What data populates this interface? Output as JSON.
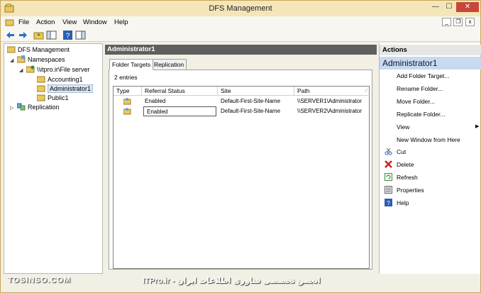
{
  "window": {
    "title": "DFS Management",
    "controls": {
      "minimize": "—",
      "maximize": "☐",
      "close": "✕"
    }
  },
  "menu": {
    "items": [
      "File",
      "Action",
      "View",
      "Window",
      "Help"
    ],
    "mdi": {
      "minimize": "_",
      "restore": "❐",
      "close": "x"
    }
  },
  "tree": {
    "root": "DFS Management",
    "namespaces": "Namespaces",
    "namespace": "\\\\itpro.ir\\File server",
    "folders": [
      "Accounting1",
      "Administrator1",
      "Public1"
    ],
    "replication": "Replication"
  },
  "center": {
    "header": "Administrator1",
    "tabs": [
      "Folder Targets",
      "Replication"
    ],
    "entries": "2 entries",
    "columns": [
      "Type",
      "Referral Status",
      "Site",
      "Path"
    ],
    "rows": [
      {
        "status": "Enabled",
        "site": "Default-First-Site-Name",
        "path": "\\\\SERVER1\\Administrator"
      },
      {
        "status": "Enabled",
        "site": "Default-First-Site-Name",
        "path": "\\\\SERVER2\\Administrator"
      }
    ]
  },
  "actions": {
    "header": "Actions",
    "section": "Administrator1",
    "items": [
      "Add Folder Target...",
      "Rename Folder...",
      "Move Folder...",
      "Replicate Folder...",
      "View",
      "New Window from Here",
      "Cut",
      "Delete",
      "Refresh",
      "Properties",
      "Help"
    ]
  },
  "watermark": {
    "left": "TOSINSO.COM",
    "right": "انجمن تخصصی فناوری اطلاعات ایران - ITPro.ir"
  },
  "colors": {
    "close_button": "#c7473a",
    "selection": "#dbe6f6",
    "panel_header": "#5f5f5f",
    "actions_section": "#c8d9f0"
  }
}
